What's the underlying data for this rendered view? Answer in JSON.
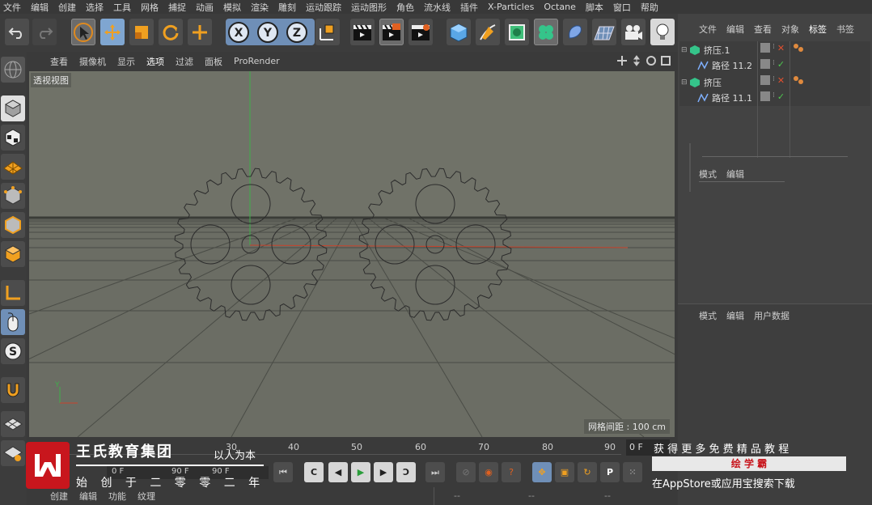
{
  "menu": [
    "文件",
    "编辑",
    "创建",
    "选择",
    "工具",
    "网格",
    "捕捉",
    "动画",
    "模拟",
    "渲染",
    "雕刻",
    "运动跟踪",
    "运动图形",
    "角色",
    "流水线",
    "插件",
    "X-Particles",
    "Octane",
    "脚本",
    "窗口",
    "帮助"
  ],
  "viewport_menu": [
    "查看",
    "摄像机",
    "显示",
    "选项",
    "过滤",
    "面板",
    "ProRender"
  ],
  "viewport": {
    "label": "透视视图",
    "grid_spacing": "网格间距 : 100 cm",
    "axis_y": "Y"
  },
  "timeline": {
    "ticks": [
      "30",
      "40",
      "50",
      "60",
      "70",
      "80",
      "90"
    ],
    "frame": "0 F",
    "start": "0 F",
    "end": "90 F",
    "end2": "90 F"
  },
  "bottom_tabs": [
    "创建",
    "编辑",
    "功能",
    "纹理"
  ],
  "coord_dashes": [
    "--",
    "--",
    "--"
  ],
  "object_manager": {
    "tabs": [
      "文件",
      "编辑",
      "查看",
      "对象",
      "标签",
      "书签"
    ],
    "objects": [
      {
        "name": "挤压.1",
        "level": 0
      },
      {
        "name": "路径 11.2",
        "level": 1
      },
      {
        "name": "挤压",
        "level": 0
      },
      {
        "name": "路径 11.1",
        "level": 1
      }
    ]
  },
  "layer_tabs": [
    "模式",
    "编辑"
  ],
  "attribute_tabs": [
    "模式",
    "编辑",
    "用户数据"
  ],
  "watermark": {
    "brand": "王氏教育集团",
    "slogan": "以人为本",
    "tagline": "始 创 于 二 零 零 二 年"
  },
  "promo": {
    "line1": "获 得 更 多 免 费 精 品 教 程",
    "site": "绘 学 霸",
    "line3": "在AppStore或应用宝搜索下载"
  },
  "colors": {
    "accent": "#6f8fb7",
    "selected_tab": "#ffffff",
    "watermark_red": "#c8161d",
    "axis_red": "#c8422b",
    "axis_green": "#3fae4a"
  }
}
